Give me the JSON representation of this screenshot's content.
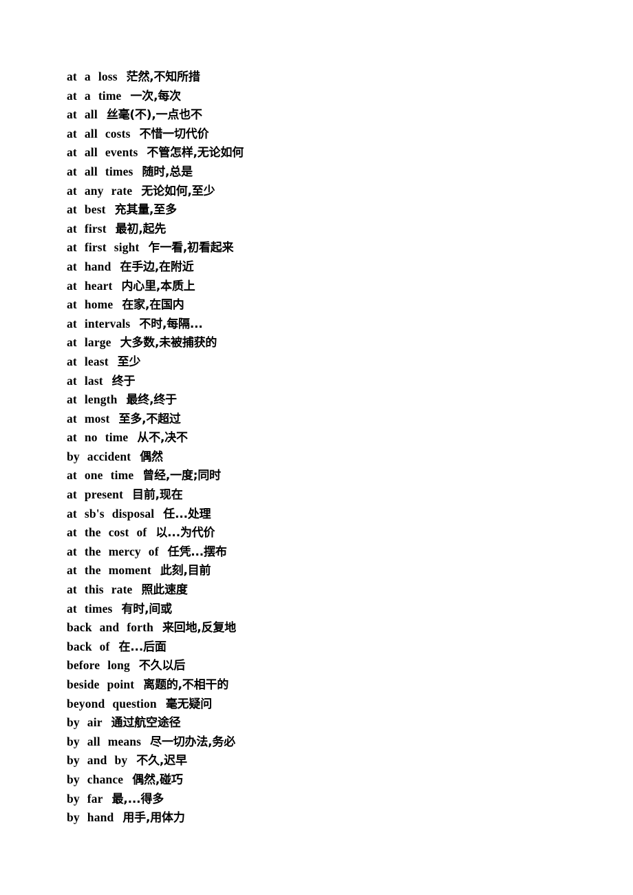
{
  "document": {
    "type": "vocabulary-phrase-list",
    "language_pair": "English-Chinese",
    "page_background": "#ffffff",
    "text_color": "#000000",
    "entry_count": 39
  },
  "entries": [
    {
      "phrase": "at   a   loss",
      "gloss": "茫然,不知所措"
    },
    {
      "phrase": "at   a   time",
      "gloss": "一次,每次"
    },
    {
      "phrase": "at   all",
      "gloss": "丝毫(不),一点也不"
    },
    {
      "phrase": "at   all   costs",
      "gloss": "不惜一切代价"
    },
    {
      "phrase": "at   all   events",
      "gloss": "不管怎样,无论如何"
    },
    {
      "phrase": "at   all   times",
      "gloss": "随时,总是"
    },
    {
      "phrase": "at   any   rate",
      "gloss": "无论如何,至少"
    },
    {
      "phrase": "at   best",
      "gloss": "充其量,至多"
    },
    {
      "phrase": "at   first",
      "gloss": "最初,起先"
    },
    {
      "phrase": "at   first   sight",
      "gloss": "乍一看,初看起来"
    },
    {
      "phrase": "at   hand",
      "gloss": "在手边,在附近"
    },
    {
      "phrase": "at   heart",
      "gloss": "内心里,本质上"
    },
    {
      "phrase": "at   home",
      "gloss": "在家,在国内"
    },
    {
      "phrase": "at   intervals",
      "gloss": "不时,每隔..."
    },
    {
      "phrase": "at   large",
      "gloss": "大多数,未被捕获的"
    },
    {
      "phrase": "at   least",
      "gloss": "至少"
    },
    {
      "phrase": "at   last",
      "gloss": "终于"
    },
    {
      "phrase": "at   length",
      "gloss": "最终,终于"
    },
    {
      "phrase": "at   most",
      "gloss": "至多,不超过"
    },
    {
      "phrase": "at   no   time",
      "gloss": "从不,决不"
    },
    {
      "phrase": "by   accident",
      "gloss": "偶然"
    },
    {
      "phrase": "at   one   time",
      "gloss": "曾经,一度;同时"
    },
    {
      "phrase": "at   present",
      "gloss": "目前,现在"
    },
    {
      "phrase": "at   sb's   disposal",
      "gloss": "任...处理"
    },
    {
      "phrase": "at   the   cost   of",
      "gloss": "以...为代价"
    },
    {
      "phrase": "at   the   mercy   of",
      "gloss": "任凭...摆布"
    },
    {
      "phrase": "at   the   moment",
      "gloss": "此刻,目前"
    },
    {
      "phrase": "at   this   rate",
      "gloss": "照此速度"
    },
    {
      "phrase": "at   times",
      "gloss": "有时,间或"
    },
    {
      "phrase": "back   and   forth",
      "gloss": "来回地,反复地"
    },
    {
      "phrase": "back   of",
      "gloss": "在...后面"
    },
    {
      "phrase": "before   long",
      "gloss": "不久以后"
    },
    {
      "phrase": "beside   point",
      "gloss": "离题的,不相干的"
    },
    {
      "phrase": "beyond   question",
      "gloss": "毫无疑问"
    },
    {
      "phrase": "by   air",
      "gloss": "通过航空途径"
    },
    {
      "phrase": "by   all   means",
      "gloss": "尽一切办法,务必"
    },
    {
      "phrase": "by   and   by",
      "gloss": "不久,迟早"
    },
    {
      "phrase": "by   chance",
      "gloss": "偶然,碰巧"
    },
    {
      "phrase": "by   far",
      "gloss": "最,...得多"
    },
    {
      "phrase": "by   hand",
      "gloss": "用手,用体力"
    }
  ]
}
